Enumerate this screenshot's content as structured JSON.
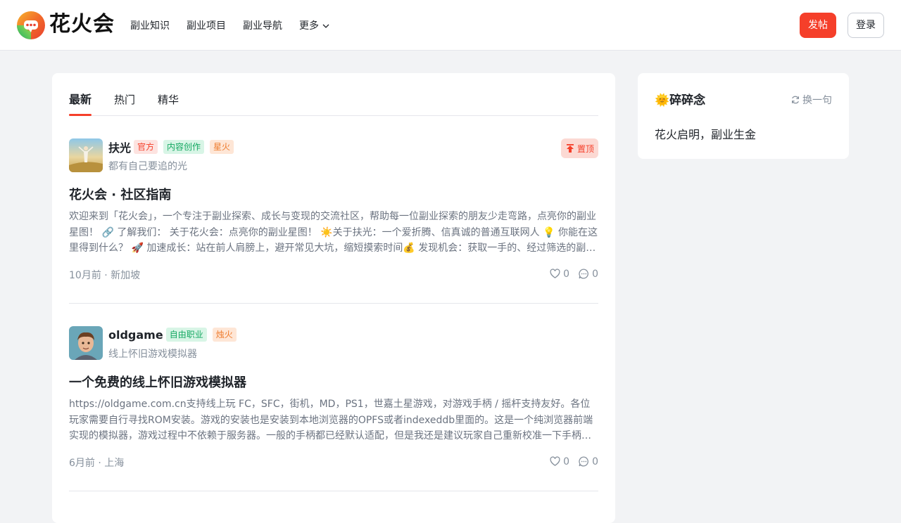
{
  "header": {
    "brand": "花火会",
    "nav": [
      {
        "label": "副业知识"
      },
      {
        "label": "副业项目"
      },
      {
        "label": "副业导航"
      },
      {
        "label": "更多"
      }
    ],
    "post_button": "发帖",
    "login_button": "登录"
  },
  "feed": {
    "tabs": [
      {
        "label": "最新",
        "active": true
      },
      {
        "label": "热门"
      },
      {
        "label": "精华"
      }
    ],
    "posts": [
      {
        "author": "扶光",
        "tags": [
          "官方",
          "内容创作",
          "星火"
        ],
        "bio": "都有自己要追的光",
        "pinned_label": "置顶",
        "title": "花火会 · 社区指南",
        "excerpt": "欢迎来到「花火会」，一个专注于副业探索、成长与变现的交流社区，帮助每一位副业探索的朋友少走弯路，点亮你的副业星图！ 🔗 了解我们： 关于花火会：点亮你的副业星图！ ☀️关于扶光：一个爱折腾、信真诚的普通互联网人 💡 你能在这里得到什么？ 🚀 加速成长：站在前人肩膀上，避开常见大坑，缩短摸索时间💰 发现机会：获取一手的、经过筛选的副业项目信息",
        "meta": "10月前 · 新加坡",
        "likes": "0",
        "comments": "0"
      },
      {
        "author": "oldgame",
        "tags": [
          "自由职业",
          "烛火"
        ],
        "bio": "线上怀旧游戏模拟器",
        "title": "一个免费的线上怀旧游戏模拟器",
        "excerpt": "https://oldgame.com.cn支持线上玩 FC，SFC，街机，MD，PS1，世嘉土星游戏，对游戏手柄 / 摇杆支持友好。各位玩家需要自行寻找ROM安装。游戏的安装也是安装到本地浏览器的OPFS或者indexeddb里面的。这是一个纯浏览器前端实现的模拟器，游戏过程中不依赖于服务器。一般的手柄都已经默认适配，但是我还是建议玩家自己重新校准一下手柄。每个游戏都可以保存进度",
        "meta": "6月前 · 上海",
        "likes": "0",
        "comments": "0"
      }
    ]
  },
  "sidebar": {
    "title": "🌞碎碎念",
    "refresh_label": "换一句",
    "quote": "花火启明，副业生金"
  },
  "colors": {
    "accent": "#f53f2a",
    "background": "#f2f3f5",
    "tag_green": "#15a862",
    "tag_orange": "#ee7a2b"
  }
}
